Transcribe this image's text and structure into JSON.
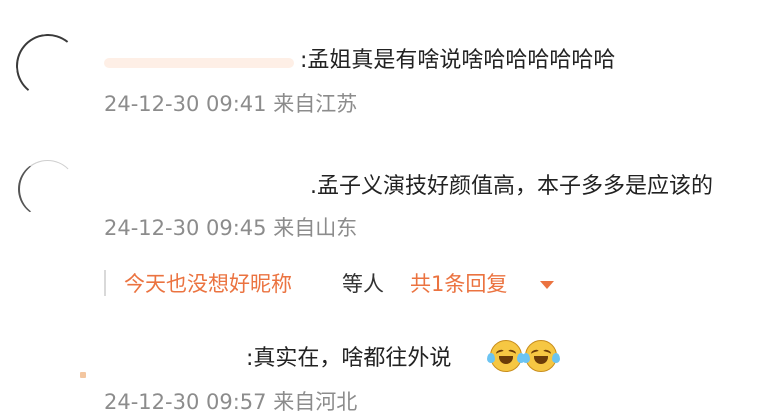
{
  "comments": [
    {
      "text": ":孟姐真是有啥说啥哈哈哈哈哈哈",
      "meta": "24-12-30 09:41 来自江苏"
    },
    {
      "text": ".孟子义演技好颜值高，本子多多是应该的",
      "meta": "24-12-30 09:45 来自山东",
      "reply": {
        "name": "今天也没想好昵称",
        "etc": "等人",
        "count": "共1条回复"
      }
    },
    {
      "text": ":真实在，啥都往外说",
      "emojis": [
        "laugh-cry-icon",
        "laugh-cry-icon"
      ],
      "meta": "24-12-30 09:57 来自河北"
    }
  ],
  "colors": {
    "accent": "#eb7340",
    "meta": "#8c8c8c",
    "text": "#222222"
  }
}
